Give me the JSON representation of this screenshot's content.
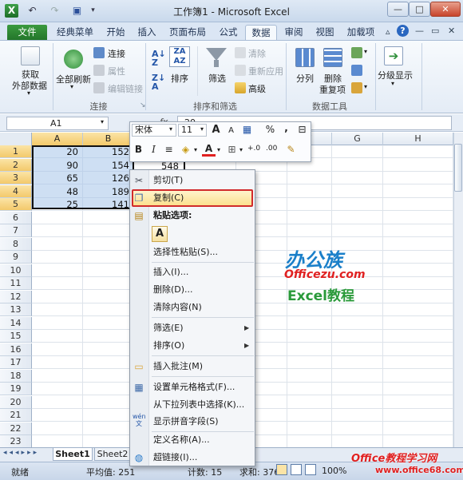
{
  "window": {
    "title": "工作簿1 - Microsoft Excel",
    "controls": {
      "minimize": "—",
      "maximize": "□",
      "close": "✕"
    }
  },
  "ribbon_tabs": [
    "文件",
    "经典菜单",
    "开始",
    "插入",
    "页面布局",
    "公式",
    "数据",
    "审阅",
    "视图",
    "加载项"
  ],
  "active_tab": "数据",
  "ribbon": {
    "get_external": [
      "获取",
      "外部数据"
    ],
    "refresh_all": "全部刷新",
    "connections": "连接",
    "properties": "属性",
    "edit_links": "编辑链接",
    "group_connections": "连接",
    "sort": "排序",
    "filter": "筛选",
    "clear": "清除",
    "reapply": "重新应用",
    "advanced": "高级",
    "group_sort_filter": "排序和筛选",
    "text_to_columns": "分列",
    "remove_duplicates": [
      "删除",
      "重复项"
    ],
    "group_data_tools": "数据工具",
    "outline": "分级显示"
  },
  "formula_bar": {
    "name_box": "A1",
    "fx": "fx",
    "formula": "20"
  },
  "columns": [
    "A",
    "B",
    "C",
    "D",
    "E",
    "F",
    "G",
    "H"
  ],
  "rows": [
    "1",
    "2",
    "3",
    "4",
    "5",
    "6",
    "7",
    "8",
    "9",
    "10",
    "11",
    "12",
    "13",
    "14",
    "15",
    "16",
    "17",
    "18",
    "19",
    "20",
    "21",
    "22",
    "23"
  ],
  "cells": {
    "A": [
      "20",
      "90",
      "65",
      "48",
      "25"
    ],
    "B": [
      "152",
      "154",
      "126",
      "189",
      "141"
    ],
    "C2": "548"
  },
  "mini_toolbar": {
    "font": "宋体",
    "size": "11",
    "grow": "A",
    "shrink": "A",
    "percent": "%",
    "comma": ",",
    "bold": "B",
    "italic": "I",
    "font_color_label": "A",
    "inc_dec": "+.0",
    "dec_dec": ".00"
  },
  "context_menu": {
    "cut": "剪切(T)",
    "copy": "复制(C)",
    "paste_options": "粘贴选项:",
    "paste_icon": "A",
    "paste_special": "选择性粘贴(S)...",
    "insert": "插入(I)...",
    "delete": "删除(D)...",
    "clear_contents": "清除内容(N)",
    "filter": "筛选(E)",
    "sort": "排序(O)",
    "insert_comment": "插入批注(M)",
    "format_cells": "设置单元格格式(F)...",
    "pick_from_list": "从下拉列表中选择(K)...",
    "phonetic": "显示拼音字段(S)",
    "define_name": "定义名称(A)...",
    "hyperlink": "超链接(I)...",
    "phonetic_icon": "wén 文"
  },
  "sheet_tabs": [
    "Sheet1",
    "Sheet2"
  ],
  "status": {
    "ready": "就绪",
    "average": "平均值: 251",
    "count": "计数: 15",
    "sum": "求和: 3765",
    "zoom": "100%"
  },
  "watermark": {
    "brand_cn": "办公族",
    "brand_url": "Officezu.com",
    "tutorial": "Excel教程",
    "footer_cn": "Office教程学习网",
    "footer_url": "www.office68.com"
  },
  "colors": {
    "file_tab": "#2f8a35",
    "selection": "#a5c4ea",
    "highlight_border": "#d12b2b",
    "watermark_red": "#e02020",
    "watermark_blue": "#1a7fc9",
    "watermark_green": "#2a9a3a"
  }
}
